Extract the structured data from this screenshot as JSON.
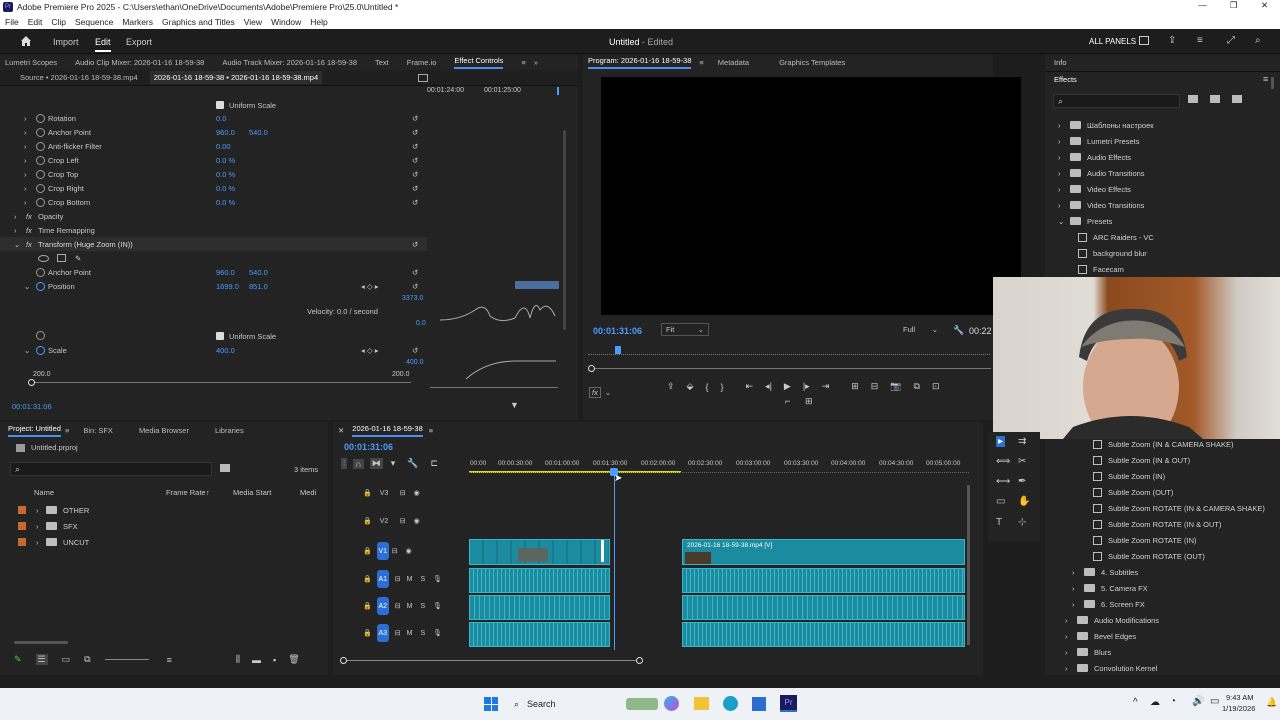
{
  "window": {
    "title": "Adobe Premiere Pro 2025 - C:\\Users\\ethan\\OneDrive\\Documents\\Adobe\\Premiere Pro\\25.0\\Untitled *",
    "min": "—",
    "max": "❐",
    "close": "✕"
  },
  "menu": [
    "File",
    "Edit",
    "Clip",
    "Sequence",
    "Markers",
    "Graphics and Titles",
    "View",
    "Window",
    "Help"
  ],
  "header": {
    "import": "Import",
    "edit": "Edit",
    "export": "Export",
    "project_title": "Untitled",
    "project_status": "- Edited",
    "all_panels": "ALL PANELS"
  },
  "source_panel": {
    "tabs": [
      "Lumetri Scopes",
      "Audio Clip Mixer: 2026-01-16 18-59-38",
      "Audio Track Mixer: 2026-01-16 18-59-38",
      "Text",
      "Frame.io",
      "Effect Controls"
    ],
    "subtabs": [
      "Source • 2026-01-16 18-59-38.mp4",
      "2026-01-16 18-59-38 • 2026-01-16 18-59-38.mp4"
    ],
    "ruler_left": "00:01:24:00",
    "ruler_right": "00:01:25:00",
    "uniform_scale": "Uniform Scale",
    "props": [
      {
        "name": "Rotation",
        "v1": "0.0",
        "v2": ""
      },
      {
        "name": "Anchor Point",
        "v1": "960.0",
        "v2": "540.0"
      },
      {
        "name": "Anti-flicker Filter",
        "v1": "0.00",
        "v2": ""
      },
      {
        "name": "Crop Left",
        "v1": "0.0 %",
        "v2": ""
      },
      {
        "name": "Crop Top",
        "v1": "0.0 %",
        "v2": ""
      },
      {
        "name": "Crop Right",
        "v1": "0.0 %",
        "v2": ""
      },
      {
        "name": "Crop Bottom",
        "v1": "0.0 %",
        "v2": ""
      }
    ],
    "opacity": "Opacity",
    "time_remapping": "Time Remapping",
    "transform": "Transform (Huge Zoom (IN))",
    "t_anchor": {
      "name": "Anchor Point",
      "v1": "960.0",
      "v2": "540.0"
    },
    "t_position": {
      "name": "Position",
      "v1": "1699.0",
      "v2": "851.0"
    },
    "graph_top": "3373.0",
    "graph_bottom": "0.0",
    "velocity": "Velocity: 0.0 / second",
    "t_uniform": "Uniform Scale",
    "t_scale": {
      "name": "Scale",
      "v1": "400.0"
    },
    "scale_graph_top": "400.0",
    "scale_min": "200.0",
    "scale_max": "200.0",
    "timecode": "00:01:31:06"
  },
  "program": {
    "tabs": [
      "Program: 2026-01-16 18-59-38",
      "Metadata",
      "Graphics Templates"
    ],
    "timecode": "00:01:31:06",
    "fit": "Fit",
    "quality": "Full",
    "duration": "00:22"
  },
  "project": {
    "tabs": [
      "Project: Untitled",
      "Bin: SFX",
      "Media Browser",
      "Libraries"
    ],
    "file": "Untitled.prproj",
    "items": "3 items",
    "cols": [
      "Name",
      "Frame Rate",
      "Media Start",
      "Medi"
    ],
    "rows": [
      {
        "name": "OTHER",
        "color": "#d2691e"
      },
      {
        "name": "SFX",
        "color": "#d2691e"
      },
      {
        "name": "UNCUT",
        "color": "#d2691e"
      }
    ]
  },
  "timeline": {
    "tab": "2026-01-16 18-59-38",
    "timecode": "00:01:31:06",
    "ruler": [
      "00:00",
      "00:00:30:00",
      "00:01:00:00",
      "00:01:30:00",
      "00:02:00:00",
      "00:02:30:00",
      "00:03:00:00",
      "00:03:30:00",
      "00:04:00:00",
      "00:04:30:00",
      "00:05:00:00"
    ],
    "tracks": [
      "V3",
      "V2",
      "V1",
      "A1",
      "A2",
      "A3"
    ],
    "clip_label": "2026-01-16 18-59-38.mp4 [V]"
  },
  "effects": {
    "info_tab": "Info",
    "effects_tab": "Effects",
    "tree": [
      {
        "label": "Шаблоны настроек",
        "depth": 0,
        "type": "folder"
      },
      {
        "label": "Lumetri Presets",
        "depth": 0,
        "type": "folder"
      },
      {
        "label": "Audio Effects",
        "depth": 0,
        "type": "folder"
      },
      {
        "label": "Audio Transitions",
        "depth": 0,
        "type": "folder"
      },
      {
        "label": "Video Effects",
        "depth": 0,
        "type": "folder"
      },
      {
        "label": "Video Transitions",
        "depth": 0,
        "type": "folder"
      },
      {
        "label": "Presets",
        "depth": 0,
        "type": "folder-open"
      },
      {
        "label": "ARC Raiders - VC",
        "depth": 1,
        "type": "preset"
      },
      {
        "label": "background blur",
        "depth": 1,
        "type": "preset"
      },
      {
        "label": "Facecam",
        "depth": 1,
        "type": "preset"
      }
    ],
    "tree_lower": [
      {
        "label": "Subtle Zoom (IN & CAMERA SHAKE)",
        "depth": 2,
        "type": "preset"
      },
      {
        "label": "Subtle Zoom (IN & OUT)",
        "depth": 2,
        "type": "preset"
      },
      {
        "label": "Subtle Zoom (IN)",
        "depth": 2,
        "type": "preset"
      },
      {
        "label": "Subtle Zoom (OUT)",
        "depth": 2,
        "type": "preset"
      },
      {
        "label": "Subtle Zoom ROTATE (IN & CAMERA SHAKE)",
        "depth": 2,
        "type": "preset"
      },
      {
        "label": "Subtle Zoom ROTATE (IN & OUT)",
        "depth": 2,
        "type": "preset"
      },
      {
        "label": "Subtle Zoom ROTATE (IN)",
        "depth": 2,
        "type": "preset"
      },
      {
        "label": "Subtle Zoom ROTATE (OUT)",
        "depth": 2,
        "type": "preset"
      },
      {
        "label": "4. Subtitles",
        "depth": 1,
        "type": "folder"
      },
      {
        "label": "5. Camera FX",
        "depth": 1,
        "type": "folder"
      },
      {
        "label": "6. Screen FX",
        "depth": 1,
        "type": "folder"
      },
      {
        "label": "Audio Modifications",
        "depth": 0,
        "type": "folder"
      },
      {
        "label": "Bevel Edges",
        "depth": 0,
        "type": "folder"
      },
      {
        "label": "Blurs",
        "depth": 0,
        "type": "folder"
      },
      {
        "label": "Convolution Kernel",
        "depth": 0,
        "type": "folder"
      }
    ]
  },
  "taskbar": {
    "search": "Search",
    "time": "9:43 AM",
    "date": "1/19/2026"
  }
}
